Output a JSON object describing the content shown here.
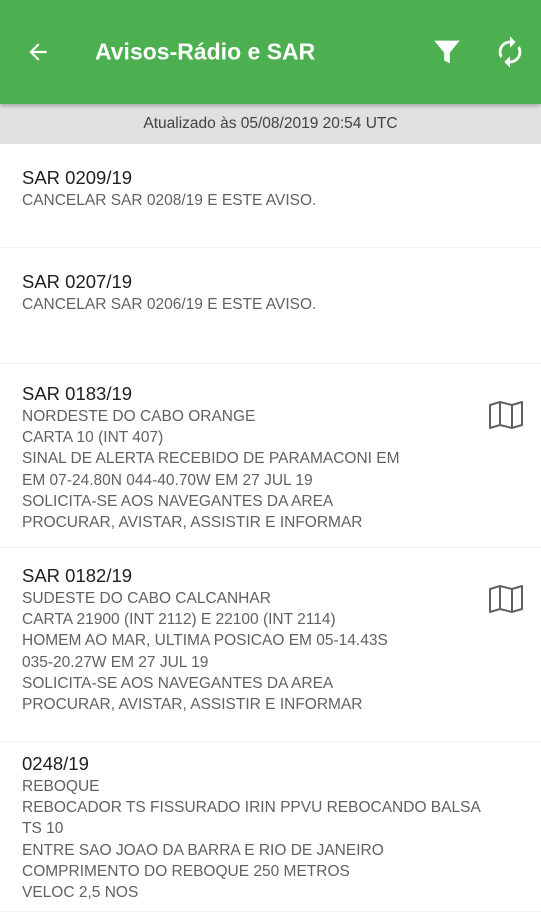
{
  "appbar": {
    "title": "Avisos-Rádio e SAR",
    "back_icon": "arrow-left-icon",
    "filter_icon": "filter-icon",
    "refresh_icon": "refresh-icon",
    "background_color": "#4CAF50"
  },
  "status": {
    "updated_text": "Atualizado às 05/08/2019 20:54 UTC"
  },
  "notices": [
    {
      "code": "SAR 0209/19",
      "lines": [
        "CANCELAR SAR 0208/19 E ESTE AVISO."
      ],
      "has_map": false
    },
    {
      "code": "SAR 0207/19",
      "lines": [
        "CANCELAR SAR 0206/19 E ESTE AVISO."
      ],
      "has_map": false
    },
    {
      "code": "SAR 0183/19",
      "lines": [
        "NORDESTE DO CABO ORANGE",
        "CARTA 10 (INT 407)",
        "SINAL DE ALERTA RECEBIDO DE PARAMACONI EM",
        "EM 07-24.80N 044-40.70W EM 27 JUL 19",
        "SOLICITA-SE AOS NAVEGANTES DA AREA",
        "PROCURAR, AVISTAR, ASSISTIR E INFORMAR"
      ],
      "has_map": true
    },
    {
      "code": "SAR 0182/19",
      "lines": [
        "SUDESTE DO CABO CALCANHAR",
        "CARTA 21900 (INT 2112) E 22100 (INT 2114)",
        "HOMEM AO MAR, ULTIMA POSICAO EM 05-14.43S",
        "035-20.27W EM 27 JUL 19",
        "SOLICITA-SE AOS NAVEGANTES DA AREA",
        "PROCURAR, AVISTAR, ASSISTIR E INFORMAR"
      ],
      "has_map": true
    },
    {
      "code": "0248/19",
      "lines": [
        "REBOQUE",
        "REBOCADOR TS FISSURADO IRIN PPVU REBOCANDO BALSA",
        "TS 10",
        "ENTRE SAO JOAO DA BARRA E RIO DE JANEIRO",
        "COMPRIMENTO DO REBOQUE 250 METROS",
        "VELOC 2,5 NOS"
      ],
      "has_map": false
    }
  ]
}
